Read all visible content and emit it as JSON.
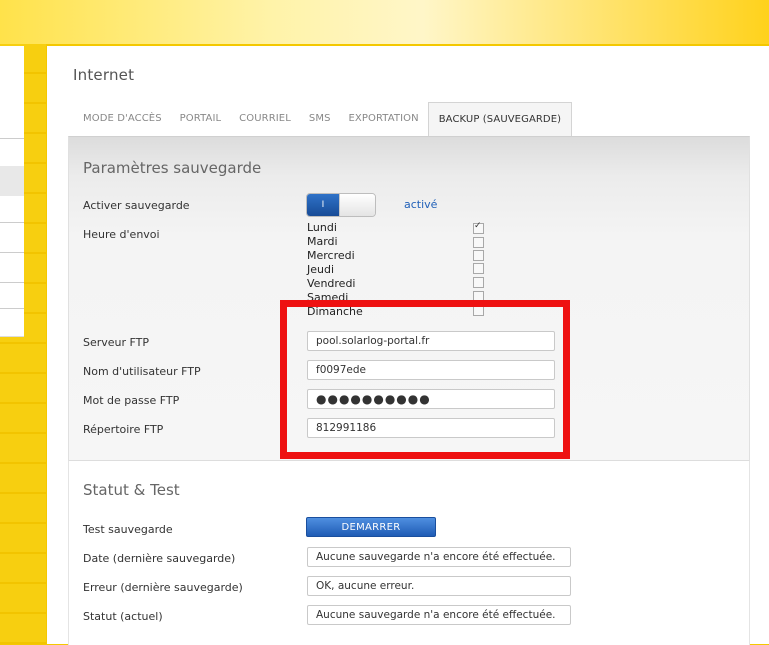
{
  "page": {
    "title": "Internet"
  },
  "tabs": [
    {
      "label": "MODE D'ACCÈS",
      "active": false
    },
    {
      "label": "PORTAIL",
      "active": false
    },
    {
      "label": "COURRIEL",
      "active": false
    },
    {
      "label": "SMS",
      "active": false
    },
    {
      "label": "EXPORTATION",
      "active": false
    },
    {
      "label": "BACKUP (SAUVEGARDE)",
      "active": true
    }
  ],
  "backup": {
    "section_title": "Paramètres sauvegarde",
    "enable_label": "Activer sauvegarde",
    "toggle_on_text": "I",
    "toggle_status": "activé",
    "send_time_label": "Heure d'envoi",
    "days": [
      {
        "name": "Lundi",
        "checked": true
      },
      {
        "name": "Mardi",
        "checked": false
      },
      {
        "name": "Mercredi",
        "checked": false
      },
      {
        "name": "Jeudi",
        "checked": false
      },
      {
        "name": "Vendredi",
        "checked": false
      },
      {
        "name": "Samedi",
        "checked": false
      },
      {
        "name": "Dimanche",
        "checked": false
      }
    ],
    "ftp_server_label": "Serveur FTP",
    "ftp_server_value": "pool.solarlog-portal.fr",
    "ftp_user_label": "Nom d'utilisateur FTP",
    "ftp_user_value": "f0097ede",
    "ftp_password_label": "Mot de passe FTP",
    "ftp_password_value": "●●●●●●●●●●",
    "ftp_dir_label": "Répertoire FTP",
    "ftp_dir_value": "812991186"
  },
  "status": {
    "section_title": "Statut & Test",
    "test_label": "Test sauvegarde",
    "start_button": "DEMARRER",
    "last_date_label": "Date (dernière sauvegarde)",
    "last_date_value": "Aucune sauvegarde n'a encore été effectuée.",
    "last_error_label": "Erreur (dernière sauvegarde)",
    "last_error_value": "OK, aucune erreur.",
    "current_label": "Statut (actuel)",
    "current_value": "Aucune sauvegarde n'a encore été effectuée."
  },
  "colors": {
    "accent_blue": "#1f5cb5",
    "highlight_red": "#ee1111",
    "brand_yellow": "#f4c800"
  }
}
